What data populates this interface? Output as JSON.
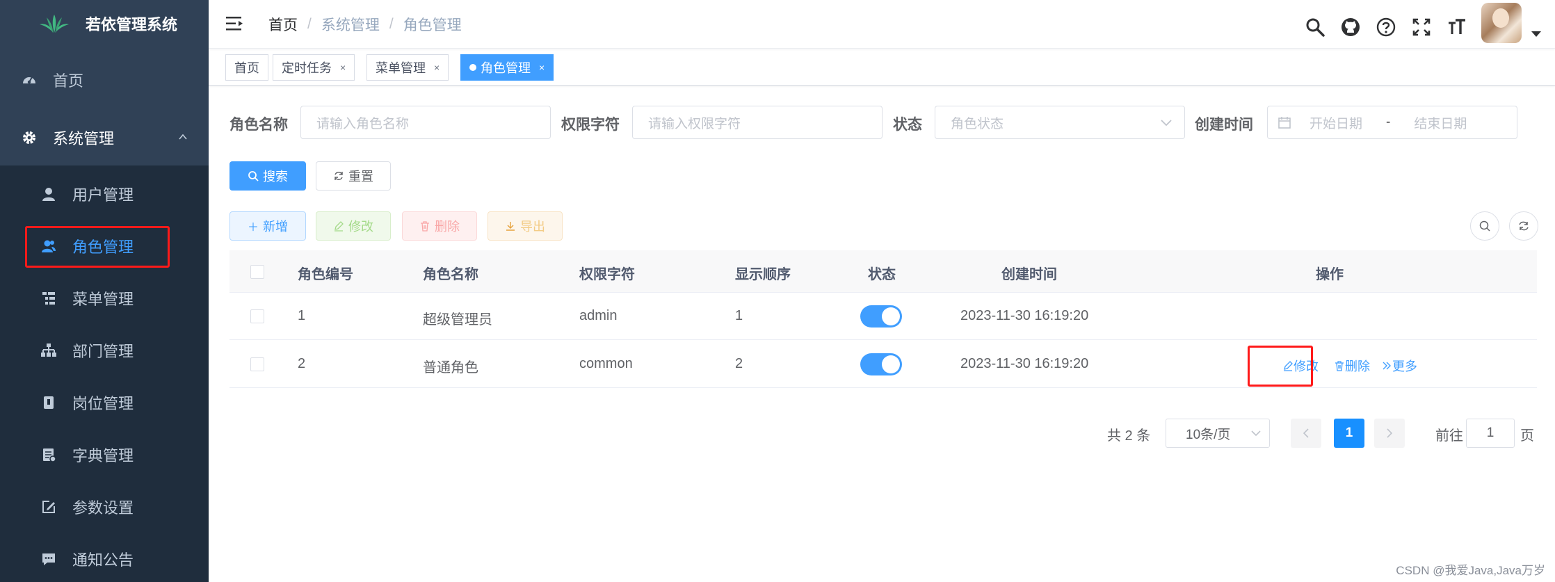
{
  "app": {
    "title": "若依管理系统"
  },
  "sidebar": {
    "items": [
      {
        "label": "首页",
        "icon": "dashboard-icon"
      },
      {
        "label": "系统管理",
        "icon": "gear-icon"
      }
    ],
    "sub_items": [
      {
        "label": "用户管理",
        "icon": "user-icon"
      },
      {
        "label": "角色管理",
        "icon": "peoples-icon"
      },
      {
        "label": "菜单管理",
        "icon": "tree-table-icon"
      },
      {
        "label": "部门管理",
        "icon": "tree-icon"
      },
      {
        "label": "岗位管理",
        "icon": "post-icon"
      },
      {
        "label": "字典管理",
        "icon": "dict-icon"
      },
      {
        "label": "参数设置",
        "icon": "edit-icon"
      },
      {
        "label": "通知公告",
        "icon": "message-icon"
      }
    ]
  },
  "breadcrumb": [
    "首页",
    "系统管理",
    "角色管理"
  ],
  "breadcrumb_sep": "/",
  "tags": [
    {
      "label": "首页"
    },
    {
      "label": "定时任务",
      "close": "×"
    },
    {
      "label": "菜单管理",
      "close": "×"
    },
    {
      "label": "角色管理",
      "close": "×"
    }
  ],
  "search": {
    "role_name_label": "角色名称",
    "role_name_placeholder": "请输入角色名称",
    "perm_label": "权限字符",
    "perm_placeholder": "请输入权限字符",
    "status_label": "状态",
    "status_placeholder": "角色状态",
    "date_label": "创建时间",
    "start_placeholder": "开始日期",
    "date_sep": "-",
    "end_placeholder": "结束日期",
    "search_btn": "搜索",
    "reset_btn": "重置"
  },
  "toolbar": {
    "add": "新增",
    "edit": "修改",
    "delete": "删除",
    "export": "导出"
  },
  "table": {
    "headers": [
      "角色编号",
      "角色名称",
      "权限字符",
      "显示顺序",
      "状态",
      "创建时间",
      "操作"
    ],
    "rows": [
      {
        "id": "1",
        "name": "超级管理员",
        "key": "admin",
        "sort": "1",
        "status": true,
        "time": "2023-11-30 16:19:20"
      },
      {
        "id": "2",
        "name": "普通角色",
        "key": "common",
        "sort": "2",
        "status": true,
        "time": "2023-11-30 16:19:20",
        "ops": {
          "edit": "修改",
          "delete": "删除",
          "more": "更多"
        }
      }
    ]
  },
  "pagination": {
    "total_text": "共 2 条",
    "page_size": "10条/页",
    "current": "1",
    "goto_label": "前往",
    "goto_value": "1",
    "page_unit": "页"
  },
  "watermark": "CSDN @我爱Java,Java万岁",
  "colors": {
    "sidebar": "#304156",
    "submenu": "#1f2d3d",
    "primary": "#409eff",
    "highlight": "#ff1a1a"
  }
}
